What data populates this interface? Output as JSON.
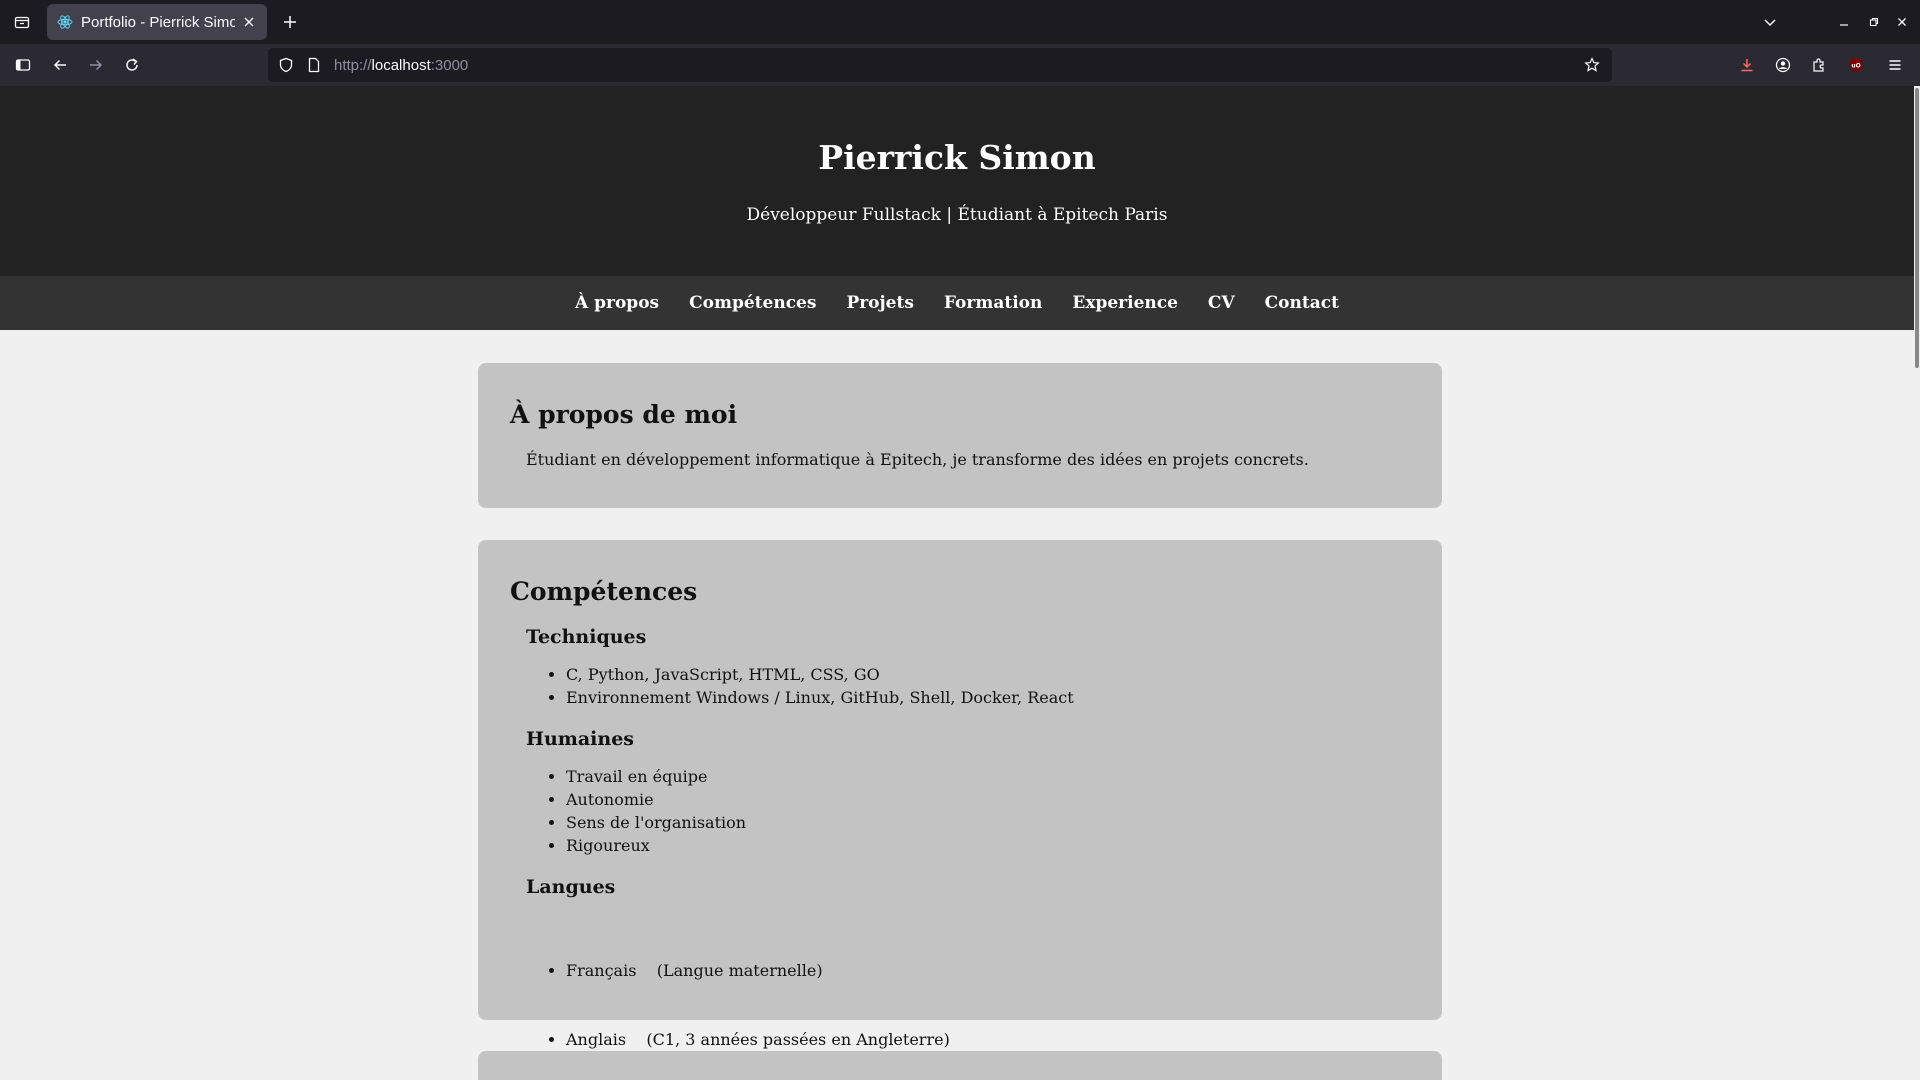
{
  "browser": {
    "tab": {
      "title": "Portfolio - Pierrick Simon"
    },
    "url": {
      "prefix": "http://",
      "host": "localhost",
      "suffix": ":3000"
    }
  },
  "header": {
    "title": "Pierrick Simon",
    "subtitle": "Développeur Fullstack | Étudiant à Epitech Paris"
  },
  "nav": {
    "items": [
      {
        "label": "À propos"
      },
      {
        "label": "Compétences"
      },
      {
        "label": "Projets"
      },
      {
        "label": "Formation"
      },
      {
        "label": "Experience"
      },
      {
        "label": "CV"
      },
      {
        "label": "Contact"
      }
    ]
  },
  "about": {
    "title": "À propos de moi",
    "text": "Étudiant en développement informatique à Epitech, je transforme des idées en projets concrets."
  },
  "skills": {
    "title": "Compétences",
    "technical": {
      "title": "Techniques",
      "items": [
        "C, Python, JavaScript, HTML, CSS, GO",
        "Environnement Windows / Linux, GitHub, Shell, Docker, React"
      ]
    },
    "human": {
      "title": "Humaines",
      "items": [
        "Travail en équipe",
        "Autonomie",
        "Sens de l'organisation",
        "Rigoureux"
      ]
    },
    "languages": {
      "title": "Langues",
      "items": [
        "Français    (Langue maternelle)",
        "Anglais    (C1, 3 années passées en Angleterre)"
      ]
    }
  },
  "colors": {
    "header_bg": "#222222",
    "nav_bg": "#333333",
    "card_bg": "#c3c3c3",
    "page_bg": "#f0f0f0"
  },
  "icons": [
    "tab-groups-icon",
    "react-favicon-icon",
    "close-icon",
    "plus-icon",
    "chevron-down-icon",
    "minimize-icon",
    "maximize-icon",
    "window-close-icon",
    "sidebar-icon",
    "back-arrow-icon",
    "forward-arrow-icon",
    "reload-icon",
    "shield-icon",
    "page-icon",
    "star-icon",
    "download-icon",
    "account-icon",
    "extensions-icon",
    "ublock-icon",
    "menu-icon"
  ]
}
